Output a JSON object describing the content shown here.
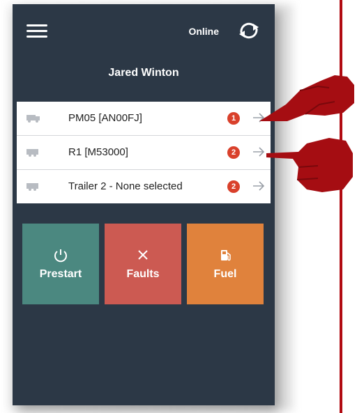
{
  "header": {
    "status": "Online"
  },
  "driver": {
    "name": "Jared Winton"
  },
  "vehicles": [
    {
      "label": "PM05 [AN00FJ]",
      "badge": "1"
    },
    {
      "label": "R1 [M53000]",
      "badge": "2"
    },
    {
      "label": "Trailer 2 - None selected",
      "badge": "2"
    }
  ],
  "actions": {
    "prestart": "Prestart",
    "faults": "Faults",
    "fuel": "Fuel"
  },
  "colors": {
    "background": "#2c3846",
    "prestart": "#4b8880",
    "faults": "#cc5a52",
    "fuel": "#e0823c",
    "badge": "#d9402b",
    "annotation": "#b10b12"
  },
  "icons": [
    "menu-icon",
    "sync-icon",
    "truck-icon",
    "arrow-right-icon",
    "power-icon",
    "close-icon",
    "fuel-pump-icon",
    "pointing-hand-icon"
  ]
}
